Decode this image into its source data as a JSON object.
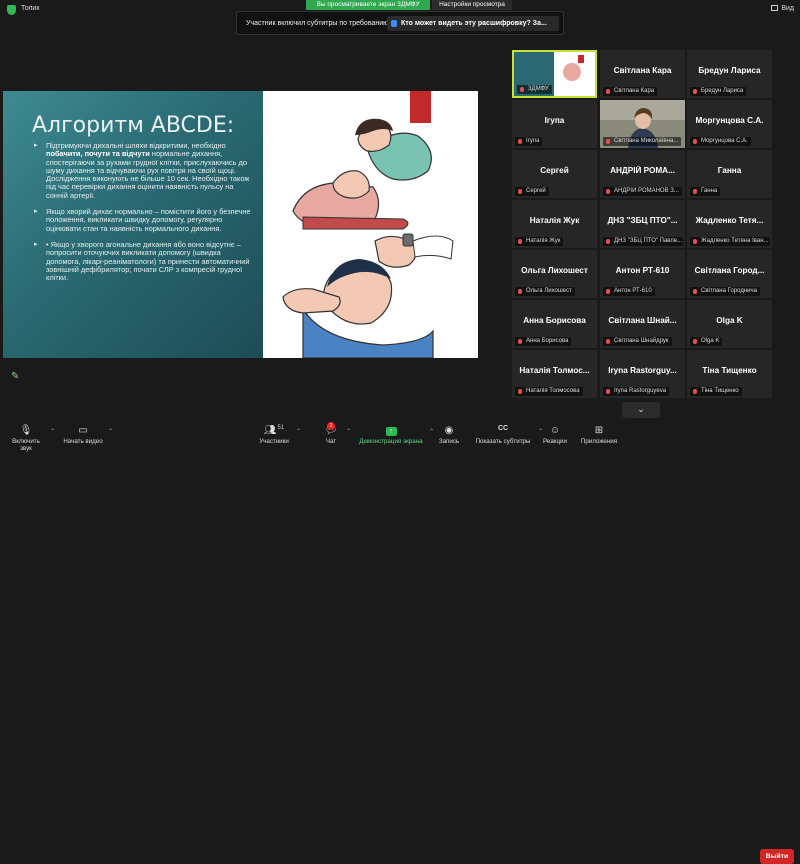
{
  "topbar": {
    "topic": "Топик",
    "viewing_banner": "Вы просматриваете экран ЗДМФУ",
    "view_options": "Настройки просмотра",
    "view_label": "Вид"
  },
  "notice": {
    "text": "Участник включил субтитры по требованию",
    "link": "Кто может видеть эту расшифровку? За..."
  },
  "slide": {
    "title": "Алгоритм ABCDE:",
    "p1_pre": "Підтримуючи дихальні шляхи відкритими, необхідно ",
    "p1_bold": "побачити, почути та відчути",
    "p1_post": " нормальне дихання, спостерігаючи за рухами грудної клітки, прислухаючись до шуму дихання та відчуваючи рух повітря на своїй щоці. Дослідження виконують не більше 10 сек. Необхідно також під час перевірки дихання оцінити наявність пульсу на сонній артерії.",
    "p2": "Якщо хворий дихає нормально – помістити його у безпечне положення, викликати швидку допомогу, регулярно оцінювати стан та наявність нормального дихання.",
    "p3": "• Якщо у хворого агональне дихання або воно відсутнє – попросити оточуючих викликати допомогу (швидка допомога, лікарі-реаніматологи) та принести автоматичний зовнішній дефібрилятор; почати СЛР з компресій грудної клітки."
  },
  "gallery": {
    "tiles": [
      {
        "name": "",
        "label": "ЗДМФУ"
      },
      {
        "name": "Світлана Кара",
        "label": "Світлана Кара"
      },
      {
        "name": "Бредун Лариса",
        "label": "Бредун Лариса"
      },
      {
        "name": "Ігупа",
        "label": "Ігупа"
      },
      {
        "name": "",
        "label": "Світлана Миколаївна..."
      },
      {
        "name": "Моргунцова С.А.",
        "label": "Моргунцова С.А."
      },
      {
        "name": "Сергей",
        "label": "Сергей"
      },
      {
        "name": "АНДРІЙ РОМА...",
        "label": "АНДРІЙ РОМАНОВ З..."
      },
      {
        "name": "Ганна",
        "label": "Ганна"
      },
      {
        "name": "Наталія Жук",
        "label": "Наталія Жук"
      },
      {
        "name": "ДНЗ \"ЗБЦ ПТО\"...",
        "label": "ДНЗ \"ЗБЦ ПТО\" Павле..."
      },
      {
        "name": "Жадленко Тетя...",
        "label": "Жадленко Тетяна Іван..."
      },
      {
        "name": "Ольга Лихошест",
        "label": "Ольга Лихошест"
      },
      {
        "name": "Антон РТ-610",
        "label": "Антон РТ-610"
      },
      {
        "name": "Світлана Город...",
        "label": "Світлана Городнича"
      },
      {
        "name": "Анна Борисова",
        "label": "Анна Борисова"
      },
      {
        "name": "Світлана Шнай...",
        "label": "Світлана Шнайдрук"
      },
      {
        "name": "Olga K",
        "label": "Olga K"
      },
      {
        "name": "Наталія Толмос...",
        "label": "Наталія Толмосова"
      },
      {
        "name": "Iryna Rastorguy...",
        "label": "Iryna Rastorguyeva"
      },
      {
        "name": "Тіна Тищенко",
        "label": "Тіна Тищенко"
      }
    ]
  },
  "toolbar": {
    "mute": "Включить звук",
    "video": "Начать видео",
    "participants": "Участники",
    "participants_count": "51",
    "chat": "Чат",
    "chat_badge": "1",
    "share": "Демонстрация экрана",
    "record": "Запись",
    "captions": "Показать субтитры",
    "captions_icon_text": "CC",
    "reactions": "Реакции",
    "apps": "Приложения",
    "leave": "Выйти"
  },
  "colors": {
    "active_speaker": "#c8e13a",
    "share_green": "#2fb855",
    "leave_red": "#d32626",
    "slide_teal": "#2a6972"
  }
}
